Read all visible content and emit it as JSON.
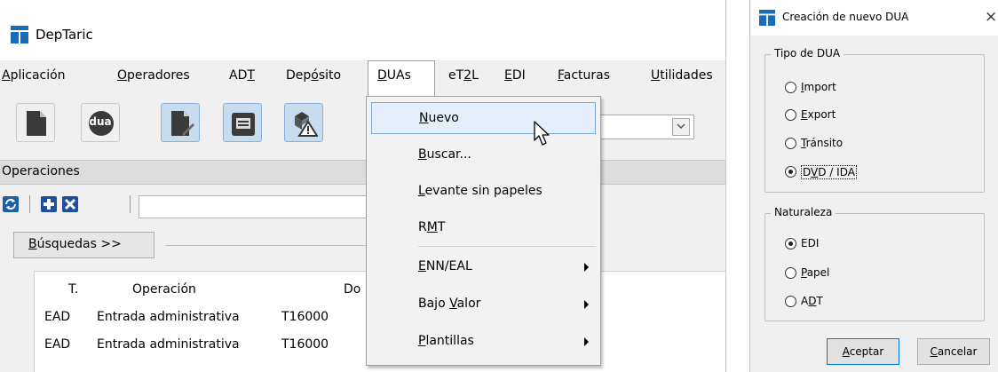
{
  "main_window": {
    "title": "DepTaric",
    "menu": [
      {
        "pre": "",
        "u": "A",
        "post": "plicación"
      },
      {
        "pre": "",
        "u": "O",
        "post": "peradores"
      },
      {
        "pre": "AD",
        "u": "T",
        "post": ""
      },
      {
        "pre": "Dep",
        "u": "ó",
        "post": "sito"
      },
      {
        "pre": "",
        "u": "D",
        "post": "UAs"
      },
      {
        "pre": "eT",
        "u": "2",
        "post": "L"
      },
      {
        "pre": "",
        "u": "E",
        "post": "DI"
      },
      {
        "pre": "",
        "u": "F",
        "post": "acturas"
      },
      {
        "pre": "",
        "u": "U",
        "post": "tilidades"
      }
    ],
    "toolbar": {
      "dua_label": "dua",
      "combo_value": ""
    },
    "operations": {
      "title": "Operaciones",
      "search_value": "",
      "busquedas": {
        "pre": "",
        "u": "B",
        "post": "úsquedas >>"
      },
      "columns": [
        "T.",
        "Operación",
        "Do"
      ],
      "rows": [
        {
          "t": "EAD",
          "op": "Entrada administrativa",
          "doc": "T16000"
        },
        {
          "t": "EAD",
          "op": "Entrada administrativa",
          "doc": "T16000"
        }
      ]
    }
  },
  "duas_menu": {
    "items": [
      {
        "pre": "",
        "u": "N",
        "post": "uevo",
        "submenu": false
      },
      {
        "pre": "",
        "u": "B",
        "post": "uscar...",
        "submenu": false
      },
      {
        "pre": "",
        "u": "L",
        "post": "evante sin papeles",
        "submenu": false
      },
      {
        "pre": "R",
        "u": "M",
        "post": "T",
        "submenu": false
      },
      {
        "pre": "",
        "u": "E",
        "post": "NN/EAL",
        "submenu": true
      },
      {
        "pre": "Bajo ",
        "u": "V",
        "post": "alor",
        "submenu": true
      },
      {
        "pre": "",
        "u": "P",
        "post": "lantillas",
        "submenu": true
      }
    ],
    "highlighted_index": 0
  },
  "dialog": {
    "title": "Creación de nuevo DUA",
    "close_glyph": "×",
    "tipo": {
      "legend": "Tipo de DUA",
      "options": [
        {
          "pre": "",
          "u": "I",
          "post": "mport",
          "checked": false
        },
        {
          "pre": "",
          "u": "E",
          "post": "xport",
          "checked": false
        },
        {
          "pre": "",
          "u": "T",
          "post": "ránsito",
          "checked": false
        },
        {
          "pre": "D",
          "u": "V",
          "post": "D / IDA",
          "checked": true
        }
      ]
    },
    "naturaleza": {
      "legend": "Naturaleza",
      "options": [
        {
          "pre": "",
          "u": "",
          "post": "EDI",
          "checked": true
        },
        {
          "pre": "",
          "u": "P",
          "post": "apel",
          "checked": false
        },
        {
          "pre": "A",
          "u": "D",
          "post": "T",
          "checked": false
        }
      ]
    },
    "accept_button": {
      "pre": "",
      "u": "A",
      "post": "ceptar"
    },
    "cancel_button": {
      "pre": "",
      "u": "C",
      "post": "ancelar"
    }
  },
  "colors": {
    "accent": "#1a6bb8",
    "highlight": "#e3eefa",
    "selected_tool": "#c8dcf0"
  },
  "icons": [
    "app-logo-icon",
    "new-document-icon",
    "dua-icon",
    "document-edit-icon",
    "manifest-icon",
    "warning-box-icon",
    "refresh-icon",
    "add-icon",
    "delete-icon",
    "mouse-cursor-icon",
    "close-icon"
  ]
}
